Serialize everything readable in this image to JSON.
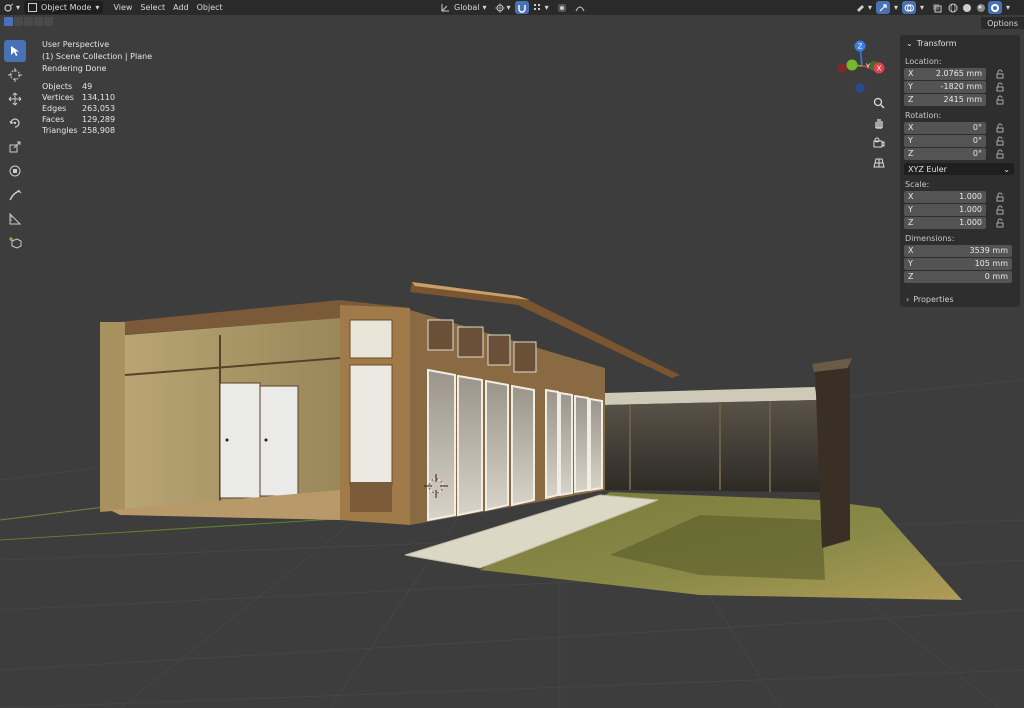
{
  "header": {
    "mode": "Object Mode",
    "menus": [
      "View",
      "Select",
      "Add",
      "Object"
    ],
    "orientation": "Global",
    "options": "Options"
  },
  "overlay": {
    "view": "User Perspective",
    "collection": "(1) Scene Collection | Plane",
    "status": "Rendering Done",
    "stats": [
      {
        "label": "Objects",
        "value": "49"
      },
      {
        "label": "Vertices",
        "value": "134,110"
      },
      {
        "label": "Edges",
        "value": "263,053"
      },
      {
        "label": "Faces",
        "value": "129,289"
      },
      {
        "label": "Triangles",
        "value": "258,908"
      }
    ]
  },
  "gizmo": {
    "z": "Z",
    "y": "Y",
    "x": "X"
  },
  "npanel": {
    "title": "Transform",
    "location_label": "Location:",
    "location": [
      {
        "axis": "X",
        "value": "2.0765 mm"
      },
      {
        "axis": "Y",
        "value": "-1820 mm"
      },
      {
        "axis": "Z",
        "value": "2415 mm"
      }
    ],
    "rotation_label": "Rotation:",
    "rotation": [
      {
        "axis": "X",
        "value": "0°"
      },
      {
        "axis": "Y",
        "value": "0°"
      },
      {
        "axis": "Z",
        "value": "0°"
      }
    ],
    "rotation_mode": "XYZ Euler",
    "scale_label": "Scale:",
    "scale": [
      {
        "axis": "X",
        "value": "1.000"
      },
      {
        "axis": "Y",
        "value": "1.000"
      },
      {
        "axis": "Z",
        "value": "1.000"
      }
    ],
    "dimensions_label": "Dimensions:",
    "dimensions": [
      {
        "axis": "X",
        "value": "3539 mm"
      },
      {
        "axis": "Y",
        "value": "105 mm"
      },
      {
        "axis": "Z",
        "value": "0 mm"
      }
    ],
    "properties": "Properties"
  },
  "colors": {
    "accent": "#4772b3",
    "x_axis": "#e0424a",
    "y_axis": "#78b82a",
    "z_axis": "#3b7de0"
  }
}
